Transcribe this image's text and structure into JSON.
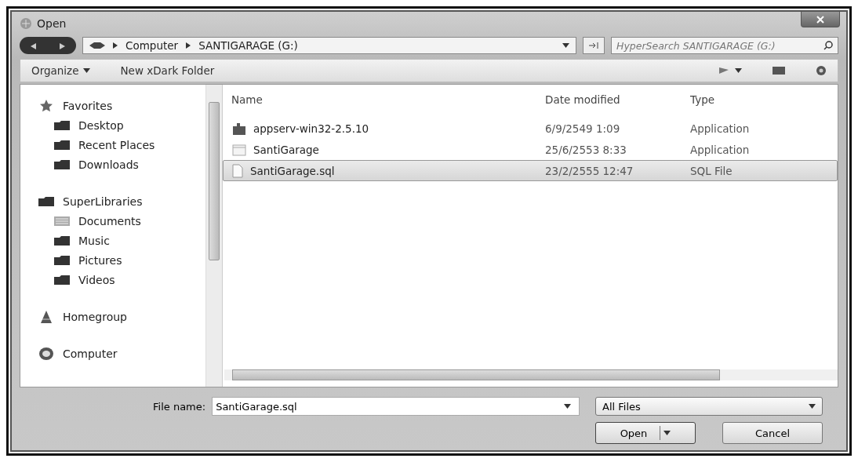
{
  "window": {
    "title": "Open"
  },
  "address_bar": {
    "crumbs": [
      "Computer",
      "SANTIGARAGE (G:)"
    ]
  },
  "search": {
    "placeholder": "HyperSearch SANTIGARAGE (G:)"
  },
  "toolbar": {
    "organize": "Organize",
    "new_folder": "New xDark Folder"
  },
  "sidebar": {
    "items": [
      {
        "label": "Favorites",
        "kind": "star",
        "children": [
          {
            "label": "Desktop",
            "kind": "folder"
          },
          {
            "label": "Recent Places",
            "kind": "folder"
          },
          {
            "label": "Downloads",
            "kind": "folder"
          }
        ]
      },
      {
        "label": "SuperLibraries",
        "kind": "folder",
        "children": [
          {
            "label": "Documents",
            "kind": "doc"
          },
          {
            "label": "Music",
            "kind": "folder"
          },
          {
            "label": "Pictures",
            "kind": "folder"
          },
          {
            "label": "Videos",
            "kind": "folder"
          }
        ]
      },
      {
        "label": "Homegroup",
        "kind": "group"
      },
      {
        "label": "Computer",
        "kind": "disk"
      }
    ]
  },
  "table": {
    "columns": [
      "Name",
      "Date modified",
      "Type"
    ],
    "rows": [
      {
        "name": "appserv-win32-2.5.10",
        "date": "6/9/2549 1:09",
        "type": "Application",
        "kind": "app",
        "selected": false
      },
      {
        "name": "SantiGarage",
        "date": "25/6/2553 8:33",
        "type": "Application",
        "kind": "blank",
        "selected": false
      },
      {
        "name": "SantiGarage.sql",
        "date": "23/2/2555 12:47",
        "type": "SQL File",
        "kind": "file",
        "selected": true
      }
    ]
  },
  "file_name": {
    "label": "File name:",
    "value": "SantiGarage.sql"
  },
  "file_type": {
    "value": "All Files"
  },
  "buttons": [
    {
      "label": "Open",
      "kind": "split"
    },
    {
      "label": "Cancel",
      "kind": "plain"
    }
  ]
}
